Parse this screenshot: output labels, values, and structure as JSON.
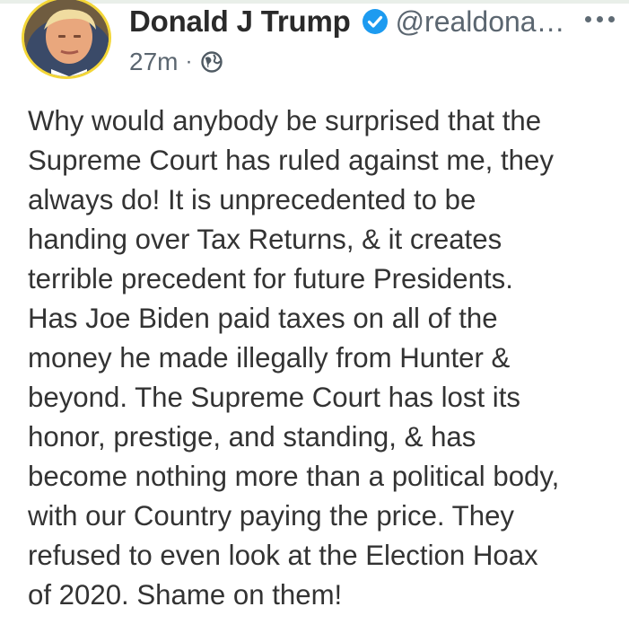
{
  "header": {
    "display_name": "Donald J Trump",
    "handle": "@realdona…",
    "time": "27m",
    "separator": "·",
    "visibility_icon": "globe-icon",
    "verified_icon": "verified-badge-icon",
    "more_icon": "more-options-icon"
  },
  "post": {
    "lines": [
      "Why would anybody be surprised that the",
      "Supreme Court has ruled against me, they",
      "always do! It is unprecedented to be",
      "handing over Tax Returns, & it creates",
      "terrible precedent for future Presidents.",
      "Has Joe Biden paid taxes on all of the",
      "money he made illegally from Hunter &",
      "beyond. The Supreme Court has lost its",
      "honor, prestige, and standing, & has",
      "become nothing more than a political body,",
      "with our Country paying the price. They",
      "refused to even look at the Election Hoax",
      "of 2020. Shame on them!"
    ]
  },
  "colors": {
    "verified_blue": "#1d9bf0",
    "avatar_ring": "#f3d637",
    "secondary_text": "#5b6670"
  }
}
